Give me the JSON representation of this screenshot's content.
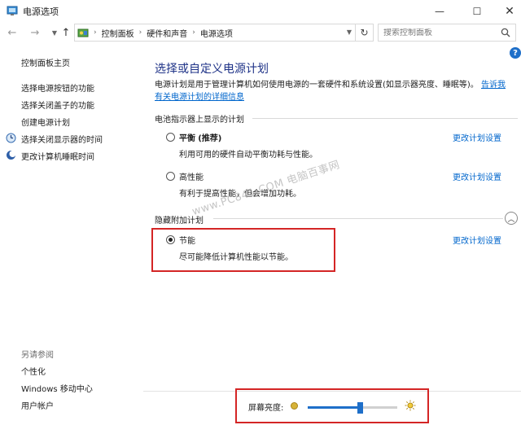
{
  "window": {
    "title": "电源选项"
  },
  "address": {
    "crumbs": [
      "控制面板",
      "硬件和声音",
      "电源选项"
    ],
    "search_placeholder": "搜索控制面板"
  },
  "left_pane": {
    "items": [
      {
        "label": "控制面板主页"
      },
      {
        "label": "选择电源按钮的功能"
      },
      {
        "label": "选择关闭盖子的功能"
      },
      {
        "label": "创建电源计划"
      },
      {
        "label": "选择关闭显示器的时间"
      },
      {
        "label": "更改计算机睡眠时间"
      }
    ],
    "see_also": "另请参阅",
    "see_also_items": [
      {
        "label": "个性化"
      },
      {
        "label": "Windows 移动中心"
      },
      {
        "label": "用户帐户"
      }
    ]
  },
  "main": {
    "title": "选择或自定义电源计划",
    "description": "电源计划是用于管理计算机如何使用电源的一套硬件和系统设置(如显示器亮度、睡眠等)。",
    "description_link": "告诉我有关电源计划的详细信息",
    "battery_group": "电池指示器上显示的计划",
    "hidden_group": "隐藏附加计划",
    "change_label": "更改计划设置",
    "plans": [
      {
        "name": "平衡",
        "tag": "(推荐)",
        "description": "利用可用的硬件自动平衡功耗与性能。",
        "selected": false
      },
      {
        "name": "高性能",
        "tag": "",
        "description": "有利于提高性能，但会增加功耗。",
        "selected": false
      },
      {
        "name": "节能",
        "tag": "",
        "description": "尽可能降低计算机性能以节能。",
        "selected": true
      }
    ],
    "watermark": "www.PC841.COM 电脑百事网"
  },
  "brightness": {
    "label": "屏幕亮度:",
    "level": 0.58
  },
  "colors": {
    "title_blue": "#1e3287",
    "link_blue": "#0066cc",
    "highlight_red": "#d42525",
    "slider_blue": "#1e6fc9"
  }
}
